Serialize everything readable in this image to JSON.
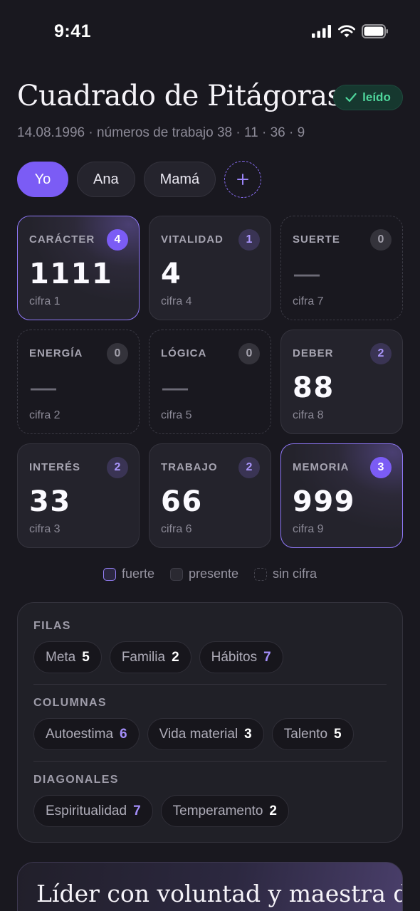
{
  "status_bar": {
    "time": "9:41"
  },
  "header": {
    "title": "Cuadrado de Pitágoras",
    "badge": "leído",
    "subtitle": "14.08.1996 · números de trabajo 38 · 11 · 36 · 9"
  },
  "profiles": {
    "items": [
      "Yo",
      "Ana",
      "Mamá"
    ],
    "selected": "Yo",
    "add_label": "+"
  },
  "grid": [
    {
      "label": "CARÁCTER",
      "count": "4",
      "value": "1111",
      "digit": "cifra 1",
      "state": "strong"
    },
    {
      "label": "VITALIDAD",
      "count": "1",
      "value": "4",
      "digit": "cifra 4",
      "state": "present"
    },
    {
      "label": "SUERTE",
      "count": "0",
      "value": "—",
      "digit": "cifra 7",
      "state": "empty"
    },
    {
      "label": "ENERGÍA",
      "count": "0",
      "value": "—",
      "digit": "cifra 2",
      "state": "empty"
    },
    {
      "label": "LÓGICA",
      "count": "0",
      "value": "—",
      "digit": "cifra 5",
      "state": "empty"
    },
    {
      "label": "DEBER",
      "count": "2",
      "value": "88",
      "digit": "cifra 8",
      "state": "present"
    },
    {
      "label": "INTERÉS",
      "count": "2",
      "value": "33",
      "digit": "cifra 3",
      "state": "present"
    },
    {
      "label": "TRABAJO",
      "count": "2",
      "value": "66",
      "digit": "cifra 6",
      "state": "present"
    },
    {
      "label": "MEMORIA",
      "count": "3",
      "value": "999",
      "digit": "cifra 9",
      "state": "strong"
    }
  ],
  "legend": {
    "strong": "fuerte",
    "present": "presente",
    "none": "sin cifra"
  },
  "lines": {
    "rows": {
      "label": "FILAS",
      "items": [
        {
          "name": "Meta",
          "value": "5",
          "highlight": false
        },
        {
          "name": "Familia",
          "value": "2",
          "highlight": false
        },
        {
          "name": "Hábitos",
          "value": "7",
          "highlight": true
        }
      ]
    },
    "columns": {
      "label": "COLUMNAS",
      "items": [
        {
          "name": "Autoestima",
          "value": "6",
          "highlight": true
        },
        {
          "name": "Vida material",
          "value": "3",
          "highlight": false
        },
        {
          "name": "Talento",
          "value": "5",
          "highlight": false
        }
      ]
    },
    "diagonals": {
      "label": "DIAGONALES",
      "items": [
        {
          "name": "Espiritualidad",
          "value": "7",
          "highlight": true
        },
        {
          "name": "Temperamento",
          "value": "2",
          "highlight": false
        }
      ]
    }
  },
  "summary": {
    "text": "Líder con voluntad y maestra de la"
  },
  "colors": {
    "accent": "#7b5cf5",
    "success": "#4fd69c",
    "background": "#19181f"
  }
}
